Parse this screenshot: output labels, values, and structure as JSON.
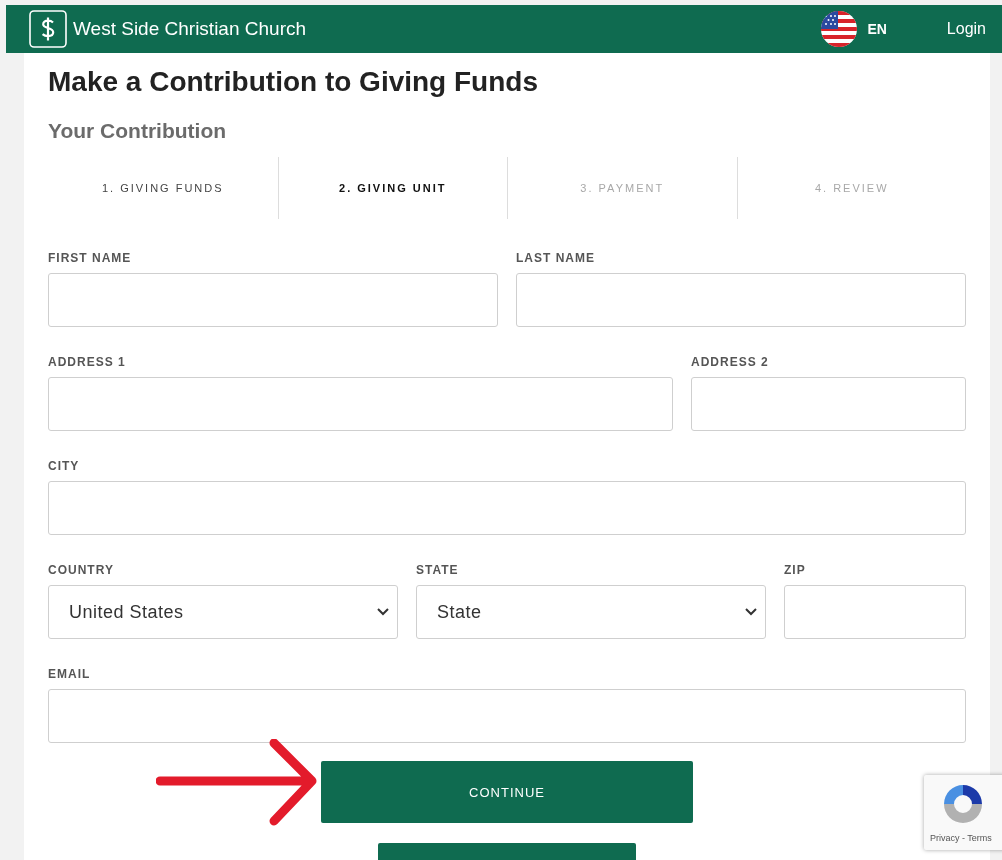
{
  "header": {
    "title": "West Side Christian Church",
    "language": "EN",
    "login": "Login"
  },
  "page": {
    "title": "Make a Contribution to Giving Funds",
    "subtitle": "Your Contribution"
  },
  "steps": [
    {
      "label": "1. GIVING FUNDS",
      "selected": false,
      "disabled": false
    },
    {
      "label": "2. GIVING UNIT",
      "selected": true,
      "disabled": false
    },
    {
      "label": "3. PAYMENT",
      "selected": false,
      "disabled": true
    },
    {
      "label": "4. REVIEW",
      "selected": false,
      "disabled": true
    }
  ],
  "form_rows": [
    [
      {
        "label": "FIRST NAME",
        "kind": "text"
      },
      {
        "label": "LAST NAME",
        "kind": "text"
      }
    ],
    [
      {
        "label": "ADDRESS 1",
        "kind": "text"
      },
      {
        "label": "ADDRESS 2",
        "kind": "text"
      }
    ],
    [
      {
        "label": "CITY",
        "kind": "text"
      }
    ],
    [
      {
        "label": "COUNTRY",
        "kind": "select",
        "value": "United States"
      },
      {
        "label": "STATE",
        "kind": "select",
        "value": "State"
      },
      {
        "label": "ZIP",
        "kind": "text"
      }
    ],
    [
      {
        "label": "EMAIL",
        "kind": "text"
      }
    ]
  ],
  "buttons": {
    "continue": "CONTINUE"
  },
  "recaptcha": {
    "links": "Privacy - Terms"
  }
}
